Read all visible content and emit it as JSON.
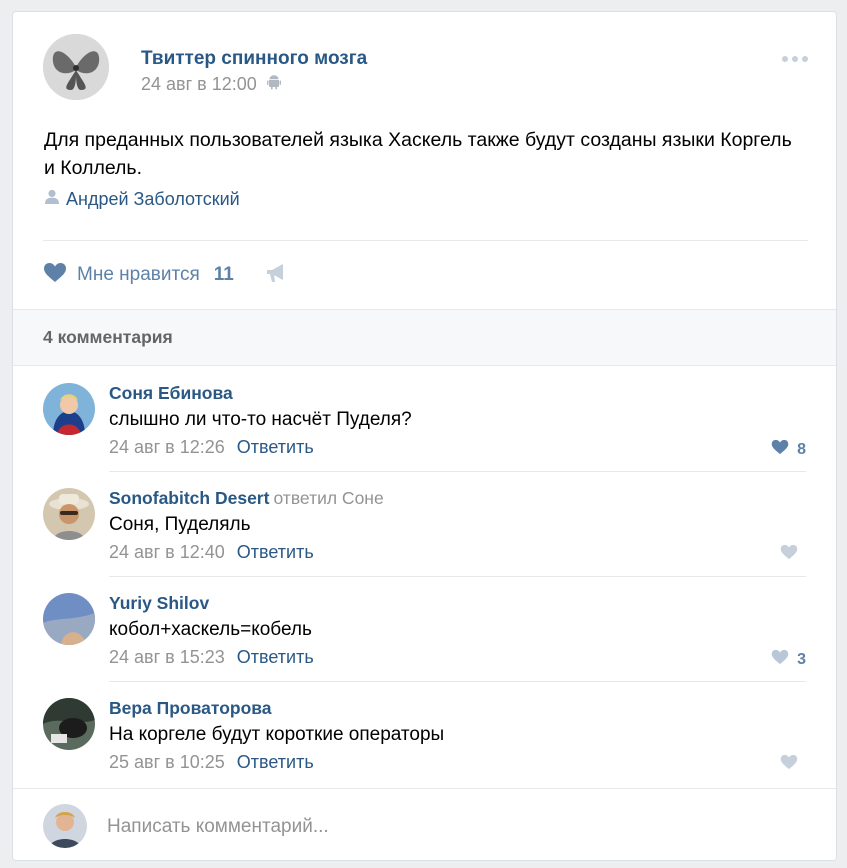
{
  "post": {
    "author": "Твиттер спинного мозга",
    "date": "24 авг в 12:00",
    "text": "Для преданных пользователей языка Хаскель также будут созданы языки Коргель и Коллель.",
    "signer": "Андрей Заболотский",
    "like_label": "Мне нравится",
    "like_count": "11",
    "icons": {
      "platform": "android-icon",
      "signer": "user-icon",
      "like": "heart-icon",
      "share": "megaphone-icon",
      "menu": "more-dots-icon"
    }
  },
  "comments_header": {
    "count_label": "4 комментария"
  },
  "comments": [
    {
      "name": "Соня Ебинова",
      "reply_to": "",
      "text": "слышно ли что-то насчёт Пуделя?",
      "date": "24 авг в 12:26",
      "reply_label": "Ответить",
      "likes": "8",
      "liked": true
    },
    {
      "name": "Sonofabitch Desert",
      "reply_to": "ответил Соне",
      "text": "Соня, Пуделяль",
      "date": "24 авг в 12:40",
      "reply_label": "Ответить",
      "likes": "",
      "liked": false
    },
    {
      "name": "Yuriy Shilov",
      "reply_to": "",
      "text": "кобол+хаскель=кобель",
      "date": "24 авг в 15:23",
      "reply_label": "Ответить",
      "likes": "3",
      "liked": false
    },
    {
      "name": "Вера Проваторова",
      "reply_to": "",
      "text": "На коргеле будут короткие операторы",
      "date": "25 авг в 10:25",
      "reply_label": "Ответить",
      "likes": "",
      "liked": false
    }
  ],
  "composer": {
    "placeholder": "Написать комментарий..."
  },
  "colors": {
    "link": "#2a5885",
    "muted": "#939393",
    "like_active": "#5e81a8",
    "like_inactive": "#c5d0db",
    "bg": "#edeef0"
  }
}
